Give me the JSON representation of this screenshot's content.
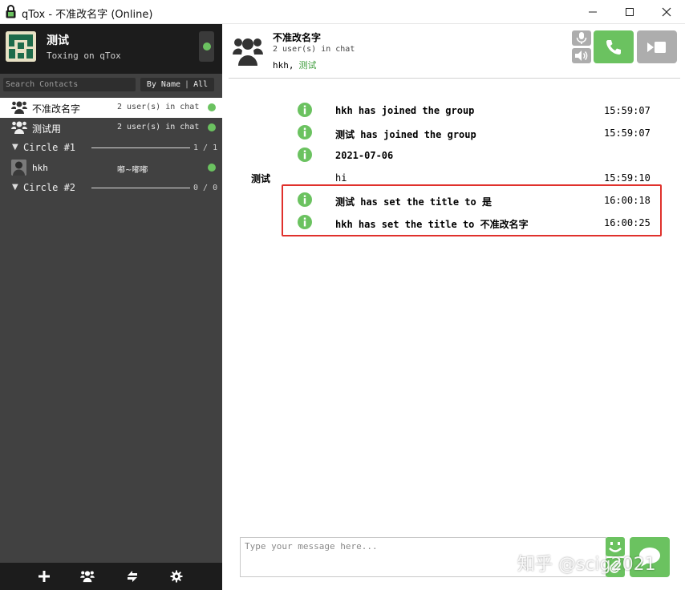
{
  "window": {
    "title": "qTox - 不准改名字 (Online)",
    "controls": {
      "minimize": "minimize",
      "maximize": "maximize",
      "close": "close"
    }
  },
  "profile": {
    "name": "测试",
    "status_message": "Toxing on qTox",
    "status": "online"
  },
  "search": {
    "placeholder": "Search Contacts"
  },
  "sort": {
    "by": "By Name",
    "separator": "|",
    "filter": "All"
  },
  "contacts": [
    {
      "type": "group",
      "name": "不准改名字",
      "status": "2 user(s) in chat",
      "active": true,
      "online": true
    },
    {
      "type": "group",
      "name": "测试用",
      "status": "2 user(s) in chat",
      "active": false,
      "online": true
    },
    {
      "type": "circle",
      "name": "Circle #1",
      "count": "1 / 1"
    },
    {
      "type": "friend",
      "name": "hkh",
      "status": "嘟~嘟嘟",
      "online": true
    },
    {
      "type": "circle",
      "name": "Circle #2",
      "count": "0 / 0"
    }
  ],
  "chat": {
    "title": "不准改名字",
    "users": "2 user(s) in chat",
    "members": [
      "hkh,",
      "测试"
    ],
    "messages": [
      {
        "author": "",
        "info": true,
        "text": "hkh has joined the group",
        "time": "15:59:07",
        "bold": true
      },
      {
        "author": "",
        "info": true,
        "text": "测试 has joined the group",
        "time": "15:59:07",
        "bold": true
      },
      {
        "author": "",
        "info": true,
        "text": "2021-07-06",
        "time": "",
        "bold": true
      },
      {
        "author": "测试",
        "info": false,
        "text": "hi",
        "time": "15:59:10",
        "bold": false
      },
      {
        "author": "",
        "info": true,
        "text": "测试 has set the title to 是",
        "time": "16:00:18",
        "bold": true
      },
      {
        "author": "",
        "info": true,
        "text": "hkh has set the title to 不准改名字",
        "time": "16:00:25",
        "bold": true
      }
    ]
  },
  "composer": {
    "placeholder": "Type your message here..."
  },
  "colors": {
    "accent": "#6bc260",
    "sidebar": "#414141",
    "sidebar_dark": "#1c1c1c",
    "highlight": "#e0312c",
    "gray_button": "#adadad"
  },
  "watermark": "知乎 @scig2021"
}
